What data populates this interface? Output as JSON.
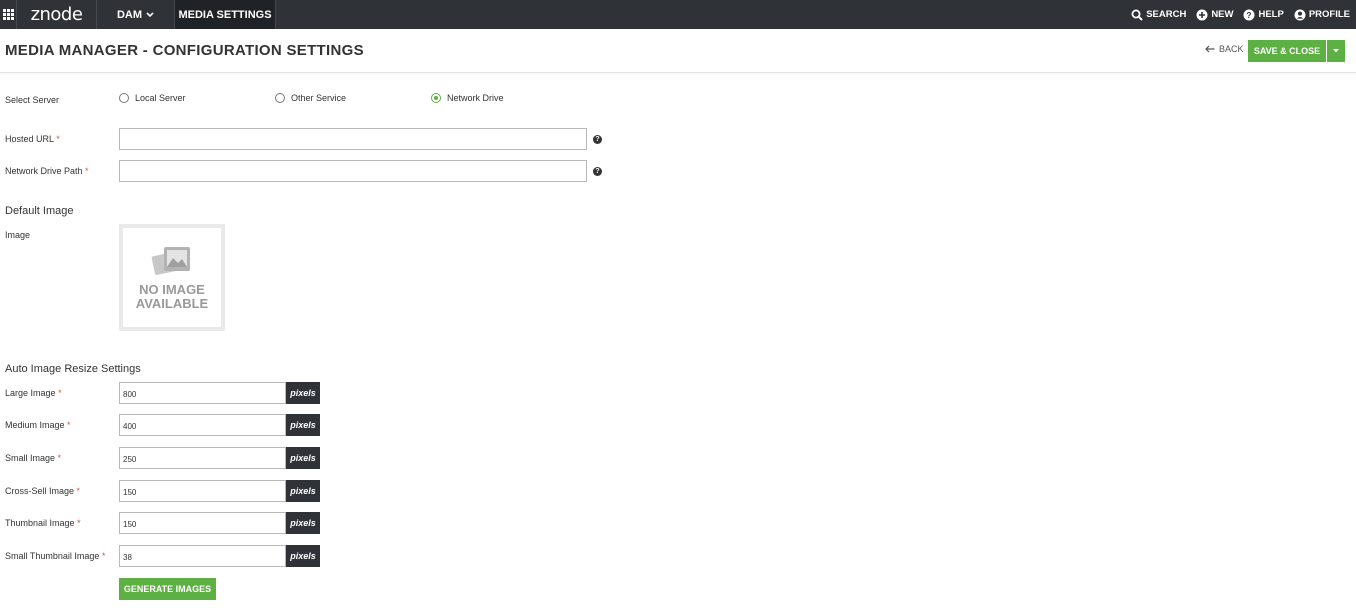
{
  "nav": {
    "logo": "znode",
    "dam_label": "DAM",
    "media_settings_label": "MEDIA SETTINGS",
    "search_label": "SEARCH",
    "new_label": "NEW",
    "help_label": "HELP",
    "profile_label": "PROFILE"
  },
  "header": {
    "title": "MEDIA MANAGER - CONFIGURATION SETTINGS",
    "back_label": "BACK",
    "save_close_label": "SAVE & CLOSE"
  },
  "form": {
    "select_server_label": "Select Server",
    "server_options": [
      {
        "label": "Local Server",
        "selected": false
      },
      {
        "label": "Other Service",
        "selected": false
      },
      {
        "label": "Network Drive",
        "selected": true
      }
    ],
    "hosted_url_label": "Hosted URL",
    "hosted_url_value": "",
    "network_drive_path_label": "Network Drive Path",
    "network_drive_path_value": "",
    "required_mark": "*",
    "help_glyph": "?"
  },
  "default_image": {
    "section_title": "Default Image",
    "image_label": "Image",
    "placeholder_line1": "NO IMAGE",
    "placeholder_line2": "AVAILABLE"
  },
  "resize": {
    "section_title": "Auto Image Resize Settings",
    "unit": "pixels",
    "rows": [
      {
        "label": "Large Image",
        "value": "800"
      },
      {
        "label": "Medium Image",
        "value": "400"
      },
      {
        "label": "Small Image",
        "value": "250"
      },
      {
        "label": "Cross-Sell Image",
        "value": "150"
      },
      {
        "label": "Thumbnail Image",
        "value": "150"
      },
      {
        "label": "Small Thumbnail Image",
        "value": "38"
      }
    ],
    "generate_label": "GENERATE IMAGES"
  },
  "colors": {
    "nav_bg": "#2f3338",
    "accent_green": "#5db042",
    "required_red": "#d9534f"
  }
}
